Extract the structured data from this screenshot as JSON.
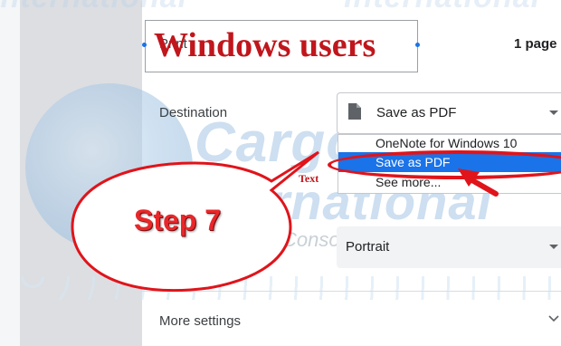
{
  "watermark": {
    "company_line1": "Cargo",
    "company_line2": "International",
    "company_line3": "Consolidators, Inc."
  },
  "annotation": {
    "title": "Windows users",
    "step_label": "Step 7",
    "small_text": "Text",
    "accent_color": "#e0141b"
  },
  "print_dialog": {
    "print_label": "Print",
    "pages_summary": "1 page",
    "destination_label": "Destination",
    "destination_value": "Save as PDF",
    "destination_icon": "document-icon",
    "destination_options": [
      "OneNote for Windows 10",
      "Save as PDF",
      "See more..."
    ],
    "orientation_value": "Portrait",
    "more_settings_label": "More settings",
    "selection_color": "#1a73e8"
  }
}
